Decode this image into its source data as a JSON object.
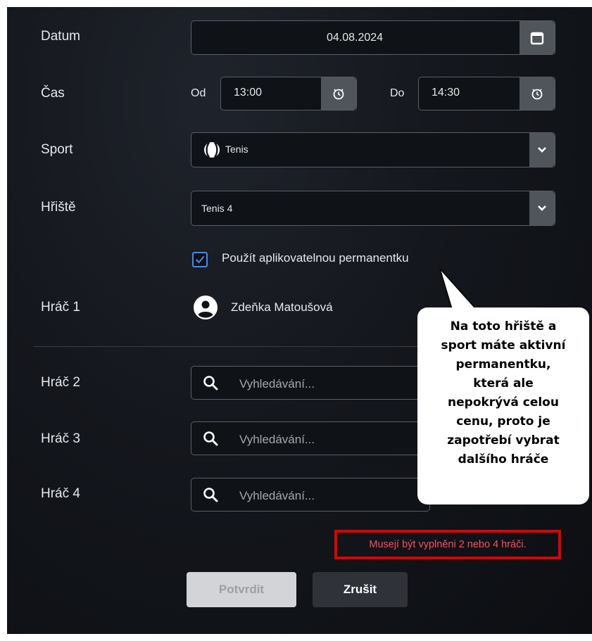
{
  "labels": {
    "datum": "Datum",
    "cas": "Čas",
    "sport": "Sport",
    "hriste": "Hřiště",
    "hrac1": "Hráč 1",
    "hrac2": "Hráč 2",
    "hrac3": "Hráč 3",
    "hrac4": "Hráč 4"
  },
  "date": {
    "value": "04.08.2024",
    "icon": "calendar-icon"
  },
  "time": {
    "from_label": "Od",
    "from_value": "13:00",
    "to_label": "Do",
    "to_value": "14:30",
    "icon": "clock-icon"
  },
  "sport": {
    "value": "Tenis",
    "icon": "tennis-ball-icon"
  },
  "court": {
    "value": "Tenis 4"
  },
  "pass_checkbox": {
    "label": "Použít aplikovatelnou permanentku",
    "checked": true
  },
  "player1": {
    "name": "Zdeňka Matoušová",
    "icon": "user-avatar-icon"
  },
  "search": {
    "placeholder": "Vyhledávání..."
  },
  "tooltip": {
    "lines": [
      "Na toto hřiště a",
      "sport máte aktivní",
      "permanentku,",
      "která ale",
      "nepokrývá celou",
      "cenu, proto je",
      "zapotřebí vybrat",
      "dalšího hráče"
    ]
  },
  "error": {
    "message": "Musejí být vyplněni 2 nebo 4 hráči."
  },
  "buttons": {
    "confirm": "Potvrdit",
    "cancel": "Zrušit"
  },
  "colors": {
    "error_text": "#ff4d5e",
    "error_border": "#e00000",
    "checkbox_accent": "#3d8bff",
    "addon_bg": "#50545b"
  }
}
